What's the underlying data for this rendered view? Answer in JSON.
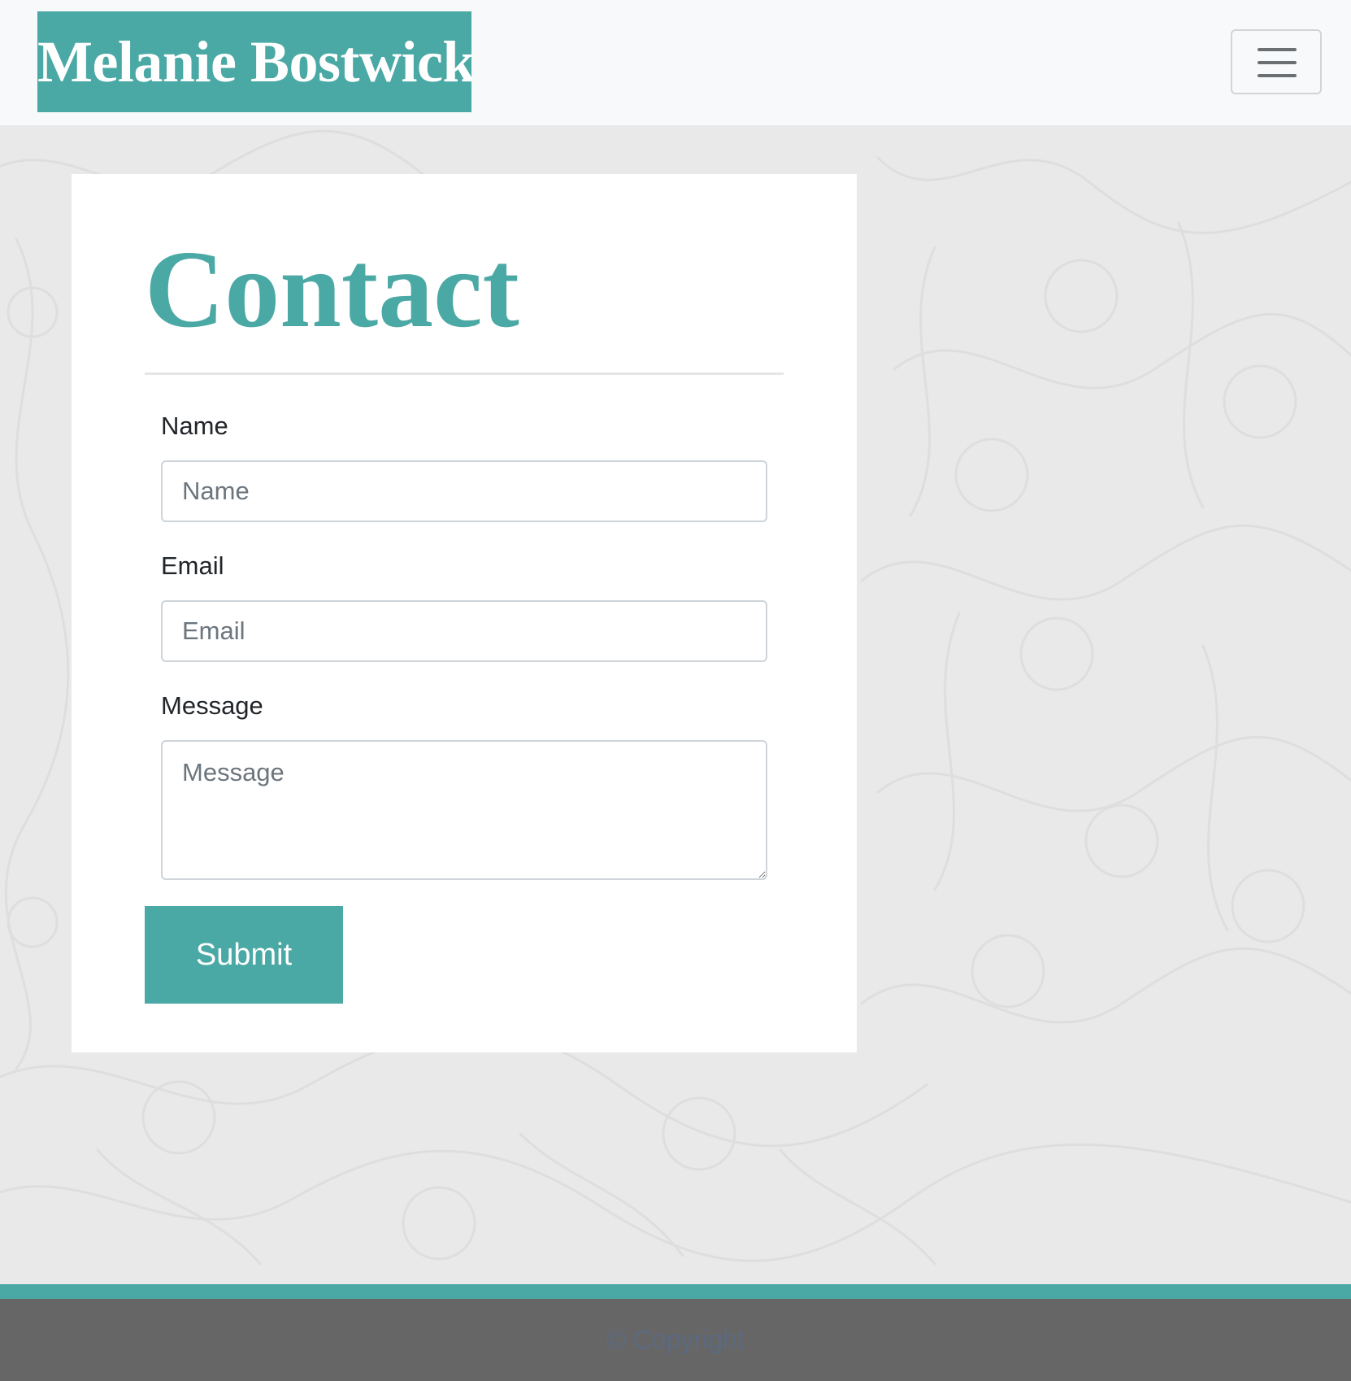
{
  "navbar": {
    "brand": "Melanie Bostwick",
    "toggler_icon": "hamburger-menu-icon"
  },
  "contact": {
    "title": "Contact",
    "name_label": "Name",
    "name_placeholder": "Name",
    "email_label": "Email",
    "email_placeholder": "Email",
    "message_label": "Message",
    "message_placeholder": "Message",
    "submit_label": "Submit"
  },
  "footer": {
    "copyright": "© Copyright"
  },
  "colors": {
    "accent": "#4ba9a5",
    "page_background": "#e9e9e9",
    "navbar_background": "#f8f9fa",
    "footer_background": "#666666",
    "footer_text": "#5c6a80"
  }
}
